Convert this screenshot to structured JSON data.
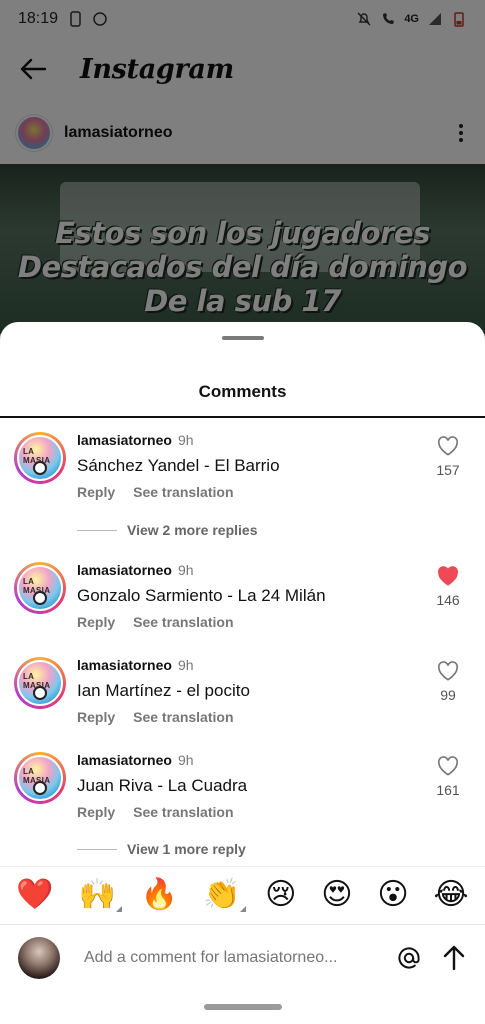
{
  "status": {
    "time": "18:19",
    "network": "4G"
  },
  "app": {
    "brand": "Instagram"
  },
  "post": {
    "user": "lamasiatorneo",
    "caption_lines": [
      "Estos son los jugadores",
      "Destacados del día domingo",
      "De la sub 17"
    ]
  },
  "sheet": {
    "title": "Comments"
  },
  "comments": [
    {
      "user": "lamasiatorneo",
      "time": "9h",
      "text": "Sánchez Yandel - El Barrio",
      "reply": "Reply",
      "translate": "See translation",
      "likes": "157",
      "liked": false
    },
    {
      "user": "lamasiatorneo",
      "time": "9h",
      "text": "Gonzalo Sarmiento - La 24 Milán",
      "reply": "Reply",
      "translate": "See translation",
      "likes": "146",
      "liked": true
    },
    {
      "user": "lamasiatorneo",
      "time": "9h",
      "text": "Ian Martínez - el pocito",
      "reply": "Reply",
      "translate": "See translation",
      "likes": "99",
      "liked": false
    },
    {
      "user": "lamasiatorneo",
      "time": "9h",
      "text": "Juan Riva - La Cuadra",
      "reply": "Reply",
      "translate": "See translation",
      "likes": "161",
      "liked": false
    }
  ],
  "replies": [
    {
      "label": "View 2 more replies"
    },
    {
      "label": "View 1 more reply"
    }
  ],
  "emojis": [
    "❤️",
    "🙌",
    "🔥",
    "👏",
    "😢",
    "😍",
    "😮",
    "😂"
  ],
  "input": {
    "placeholder": "Add a comment for lamasiatorneo..."
  },
  "colors": {
    "like_red": "#ed4956",
    "text": "#111111",
    "muted": "#777777"
  }
}
